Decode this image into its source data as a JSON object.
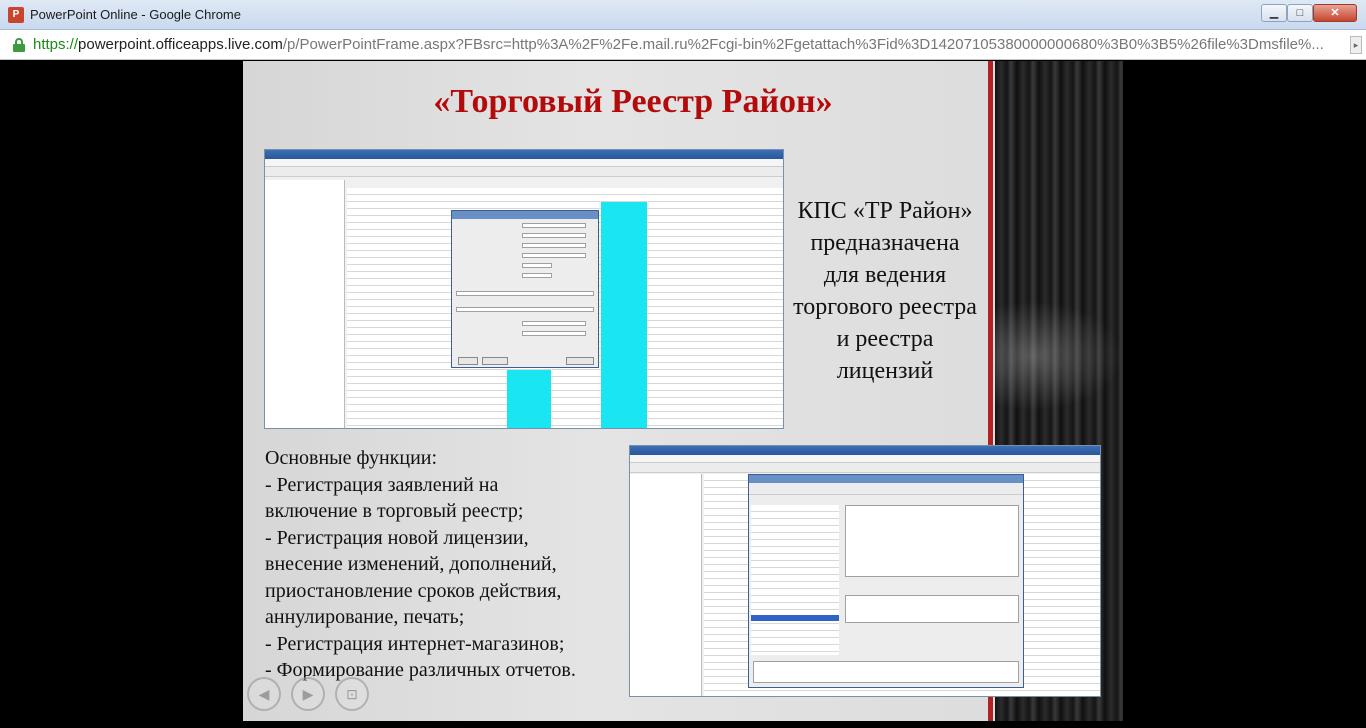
{
  "window": {
    "title": "PowerPoint Online - Google Chrome",
    "app_icon": "powerpoint-icon",
    "controls": {
      "minimize": "▁",
      "maximize": "□",
      "close": "✕"
    }
  },
  "address_bar": {
    "scheme": "https://",
    "host": "powerpoint.officeapps.live.com",
    "path": "/p/PowerPointFrame.aspx?FBsrc=http%3A%2F%2Fe.mail.ru%2Fcgi-bin%2Fgetattach%3Fid%3D14207105380000000680%3B0%3B5%26file%3Dmsfile%..."
  },
  "slide": {
    "title": "«Торговый Реестр Район»",
    "description_lines": [
      "КПС «ТР Район»",
      "предназначена",
      "для ведения",
      "торгового реестра",
      "и реестра",
      "лицензий"
    ],
    "functions_lines": [
      "Основные функции:",
      "- Регистрация заявлений на",
      "включение в торговый реестр;",
      "- Регистрация новой лицензии,",
      "внесение изменений, дополнений,",
      "приостановление сроков действия,",
      "аннулирование, печать;",
      "- Регистрация интернет-магазинов;",
      "- Формирование различных отчетов."
    ]
  },
  "nav": {
    "prev": "◀",
    "next": "▶",
    "fullscreen": "⊡"
  },
  "colors": {
    "title_red": "#b30b0b",
    "accent_red_bar": "#b32222",
    "cyan_column": "#19e6f0"
  }
}
